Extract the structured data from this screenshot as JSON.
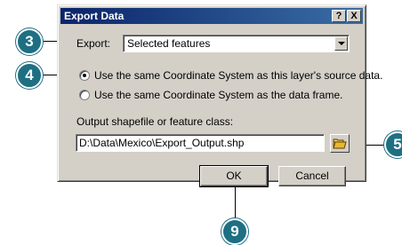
{
  "dialog": {
    "title": "Export Data",
    "help_button": "?",
    "close_button": "X",
    "export_label": "Export:",
    "export_value": "Selected features",
    "radio_options": [
      {
        "label": "Use the same Coordinate System as this layer's source data.",
        "selected": true
      },
      {
        "label": "Use the same Coordinate System as the data frame.",
        "selected": false
      }
    ],
    "output_label": "Output shapefile or feature class:",
    "output_value": "D:\\Data\\Mexico\\Export_Output.shp",
    "ok_label": "OK",
    "cancel_label": "Cancel"
  },
  "callouts": [
    "3",
    "4",
    "5",
    "9"
  ],
  "colors": {
    "callout_fill": "#1f6f83",
    "titlebar_start": "#0a246a",
    "titlebar_end": "#3a6ea5",
    "dialog_face": "#d4d0c8"
  },
  "icons": {
    "browse": "open-folder-icon"
  }
}
